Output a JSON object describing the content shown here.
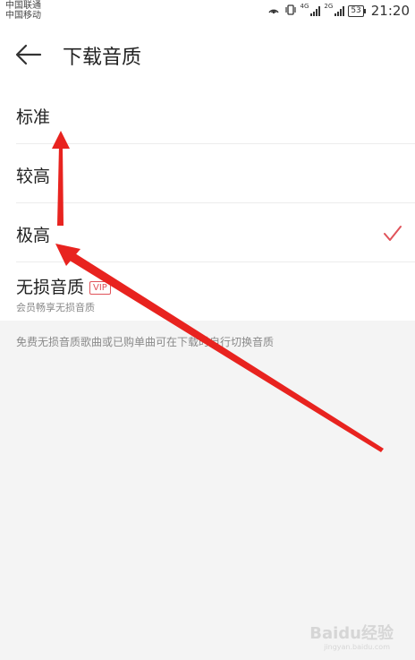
{
  "status_bar": {
    "carrier1": "中国联通",
    "carrier2": "中国移动",
    "net1": "4G",
    "net2": "2G",
    "battery": "53",
    "time": "21:20"
  },
  "header": {
    "title": "下载音质"
  },
  "quality_options": [
    {
      "label": "标准",
      "selected": false
    },
    {
      "label": "较高",
      "selected": false
    },
    {
      "label": "极高",
      "selected": true
    },
    {
      "label": "无损音质",
      "badge": "VIP",
      "subtitle": "会员畅享无损音质",
      "selected": false
    }
  ],
  "footer_note": "免费无损音质歌曲或已购单曲可在下载时自行切换音质",
  "watermark": {
    "text": "Baidu经验",
    "sub": "jingyan.baidu.com"
  },
  "colors": {
    "accent": "#e0535a",
    "annotation": "#e8231f"
  }
}
